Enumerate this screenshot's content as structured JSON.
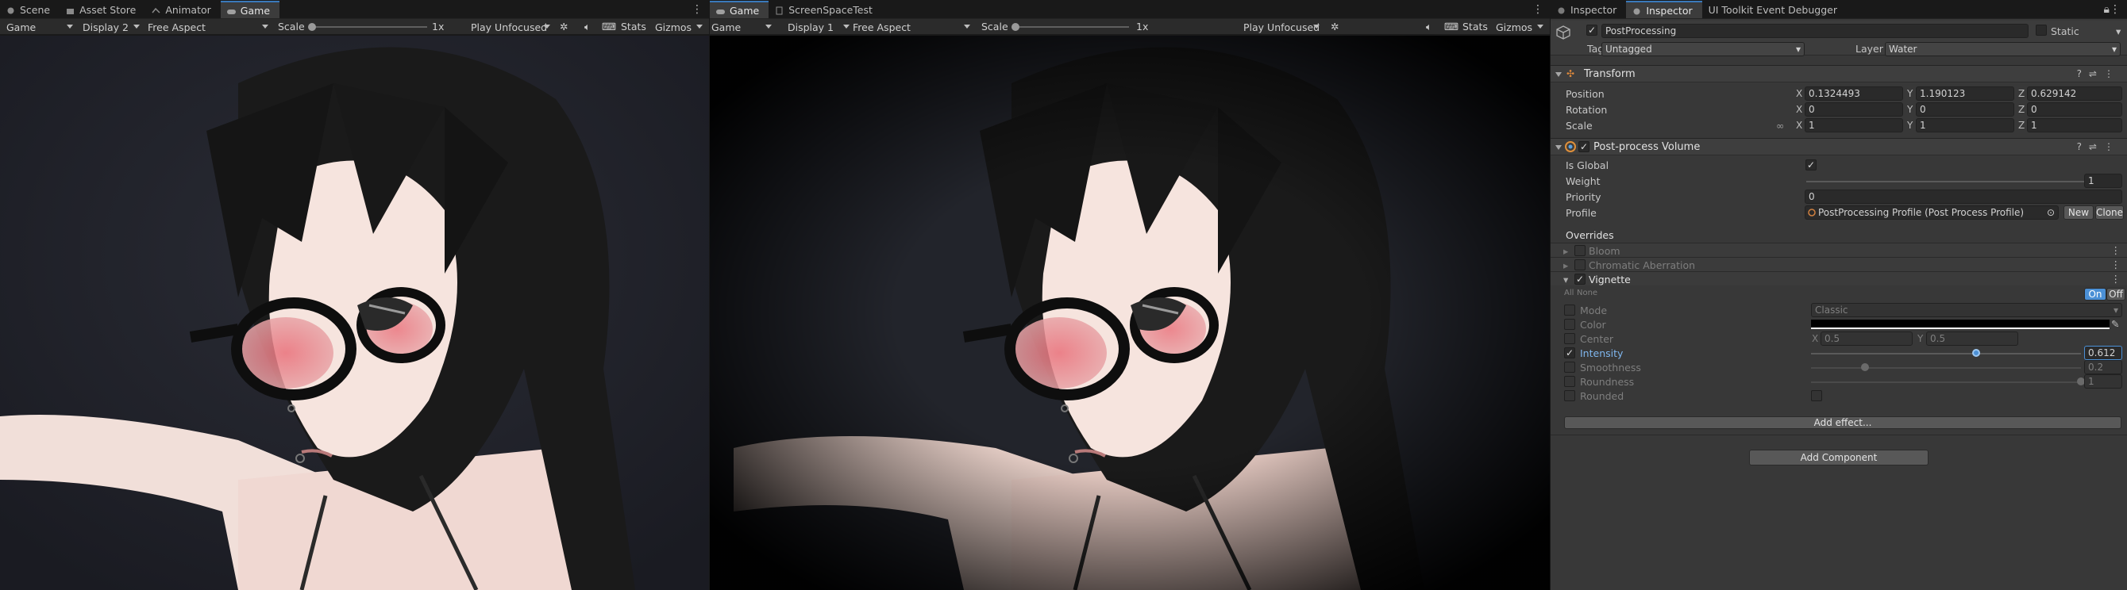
{
  "left_tabs": [
    "Scene",
    "Asset Store",
    "Animator",
    "Game"
  ],
  "mid_tabs": [
    "Game",
    "ScreenSpaceTest"
  ],
  "right_tabs": [
    "Inspector",
    "Inspector",
    "UI Toolkit Event Debugger"
  ],
  "game1": {
    "view": "Game",
    "display": "Display 2",
    "aspect": "Free Aspect",
    "scale_label": "Scale",
    "scale_value": "1x",
    "play_mode": "Play Unfocused",
    "stats": "Stats",
    "gizmos": "Gizmos"
  },
  "game2": {
    "view": "Game",
    "display": "Display 1",
    "aspect": "Free Aspect",
    "scale_label": "Scale",
    "scale_value": "1x",
    "play_mode": "Play Unfocused",
    "stats": "Stats",
    "gizmos": "Gizmos"
  },
  "object": {
    "name": "PostProcessing",
    "static_label": "Static",
    "tag_label": "Tag",
    "tag": "Untagged",
    "layer_label": "Layer",
    "layer": "Water"
  },
  "transform": {
    "title": "Transform",
    "position_label": "Position",
    "rotation_label": "Rotation",
    "scale_label": "Scale",
    "position": {
      "x": "0.1324493",
      "y": "1.190123",
      "z": "0.629142"
    },
    "rotation": {
      "x": "0",
      "y": "0",
      "z": "0"
    },
    "scale": {
      "x": "1",
      "y": "1",
      "z": "1"
    },
    "x": "X",
    "y": "Y",
    "z": "Z"
  },
  "volume": {
    "title": "Post-process Volume",
    "is_global_label": "Is Global",
    "weight_label": "Weight",
    "weight": "1",
    "weight_fraction": 1.0,
    "priority_label": "Priority",
    "priority": "0",
    "profile_label": "Profile",
    "profile": "PostProcessing Profile (Post Process Profile)",
    "new_button": "New",
    "clone_button": "Clone",
    "overrides_label": "Overrides",
    "effects": [
      "Bloom",
      "Chromatic Aberration",
      "Vignette"
    ],
    "all_label": "All",
    "none_label": "None",
    "on_label": "On",
    "off_label": "Off"
  },
  "vignette": {
    "mode_label": "Mode",
    "mode": "Classic",
    "color_label": "Color",
    "color": "#000000",
    "center_label": "Center",
    "center_x": "0.5",
    "center_y": "0.5",
    "intensity_label": "Intensity",
    "intensity": "0.612",
    "intensity_fraction": 0.612,
    "smoothness_label": "Smoothness",
    "smoothness": "0.2",
    "smoothness_fraction": 0.2,
    "roundness_label": "Roundness",
    "roundness": "1",
    "roundness_fraction": 1.0,
    "rounded_label": "Rounded"
  },
  "add_effect": "Add effect...",
  "add_component": "Add Component",
  "colors": {
    "accent": "#3a79bb",
    "panel": "#383838",
    "toolbar": "#2b2b2b",
    "selected_blue": "#4b90d6"
  }
}
